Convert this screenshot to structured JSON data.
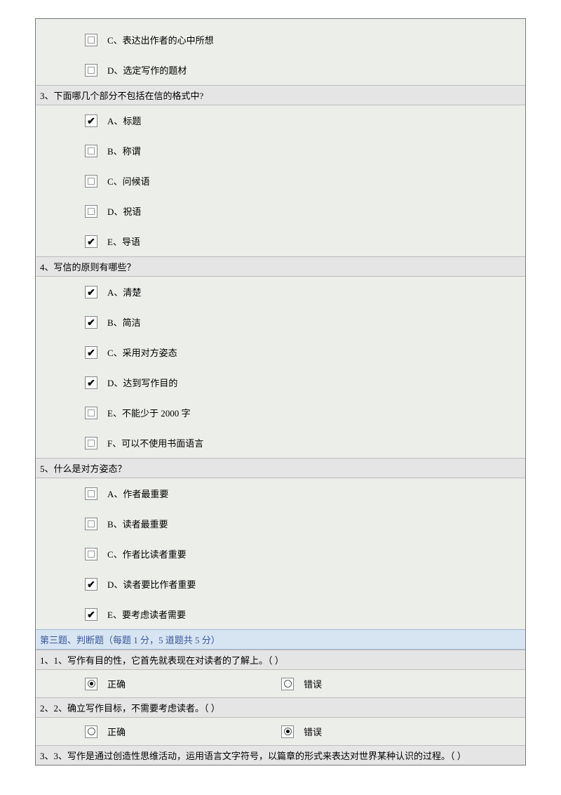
{
  "partialQ2": {
    "options": [
      {
        "label": "C、表达出作者的心中所想",
        "checked": false
      },
      {
        "label": "D、选定写作的题材",
        "checked": false
      }
    ]
  },
  "q3": {
    "title": "3、下面哪几个部分不包括在信的格式中?",
    "options": [
      {
        "label": "A、标题",
        "checked": true
      },
      {
        "label": "B、称谓",
        "checked": false
      },
      {
        "label": "C、问候语",
        "checked": false
      },
      {
        "label": "D、祝语",
        "checked": false
      },
      {
        "label": "E、导语",
        "checked": true
      }
    ]
  },
  "q4": {
    "title": "4、写信的原则有哪些？",
    "options": [
      {
        "label": "A、清楚",
        "checked": true
      },
      {
        "label": "B、简洁",
        "checked": true
      },
      {
        "label": "C、采用对方姿态",
        "checked": true
      },
      {
        "label": "D、达到写作目的",
        "checked": true
      },
      {
        "label": "E、不能少于 2000 字",
        "checked": false
      },
      {
        "label": "F、可以不使用书面语言",
        "checked": false
      }
    ]
  },
  "q5": {
    "title": "5、什么是对方姿态？",
    "options": [
      {
        "label": "A、作者最重要",
        "checked": false
      },
      {
        "label": "B、读者最重要",
        "checked": false
      },
      {
        "label": "C、作者比读者重要",
        "checked": false
      },
      {
        "label": "D、读者要比作者重要",
        "checked": true
      },
      {
        "label": "E、要考虑读者需要",
        "checked": true
      }
    ]
  },
  "section3": {
    "header": "第三题、判断题（每题 1 分，5 道题共 5 分）",
    "correct": "正确",
    "wrong": "错误",
    "q1": {
      "title": "1、1、写作有目的性，它首先就表现在对读者的了解上。（ ）",
      "answer": "correct"
    },
    "q2": {
      "title": "2、2、确立写作目标，不需要考虑读者。（ ）",
      "answer": "wrong"
    },
    "q3": {
      "title": "3、3、写作是通过创造性思维活动，运用语言文字符号，以篇章的形式来表达对世界某种认识的过程。（ ）"
    }
  }
}
